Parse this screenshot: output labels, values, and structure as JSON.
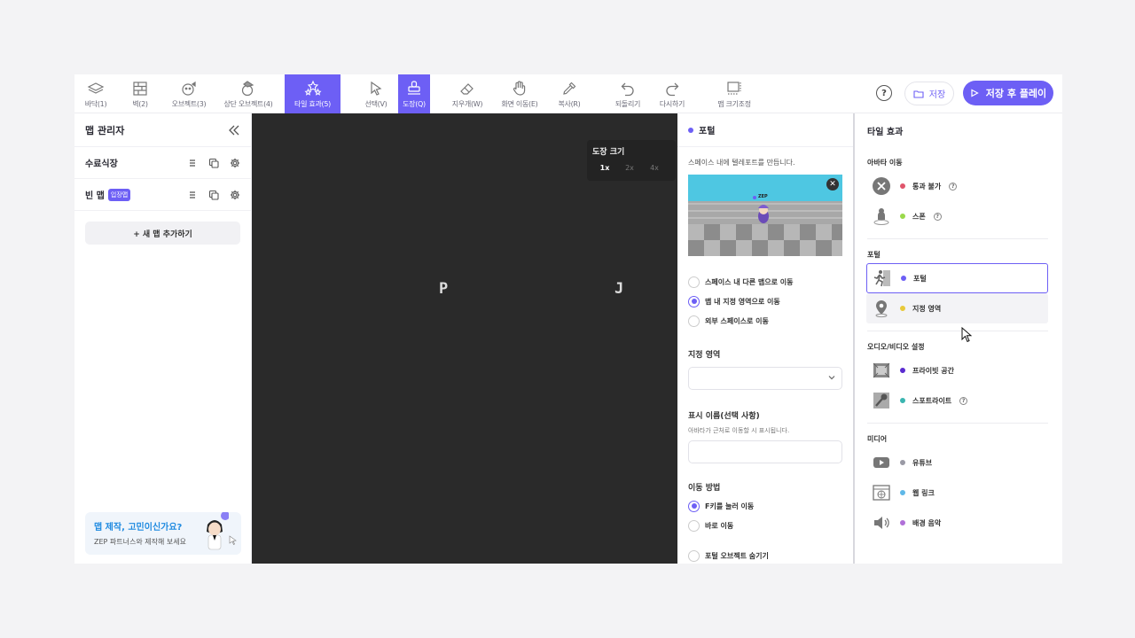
{
  "toolbar": {
    "tools": [
      {
        "label": "바닥(1)",
        "icon": "floor-icon"
      },
      {
        "label": "벽(2)",
        "icon": "wall-icon"
      },
      {
        "label": "오브젝트(3)",
        "icon": "object-icon"
      },
      {
        "label": "상단 오브젝트(4)",
        "icon": "top-object-icon"
      },
      {
        "label": "타일 효과(5)",
        "icon": "tile-effect-icon"
      },
      {
        "label": "선택(V)",
        "icon": "select-cursor-icon"
      },
      {
        "label": "도장(Q)",
        "icon": "stamp-icon"
      },
      {
        "label": "지우개(W)",
        "icon": "eraser-icon"
      },
      {
        "label": "화면 이동(E)",
        "icon": "hand-icon"
      },
      {
        "label": "복사(R)",
        "icon": "eyedropper-icon"
      },
      {
        "label": "되돌리기",
        "icon": "undo-icon"
      },
      {
        "label": "다시하기",
        "icon": "redo-icon"
      },
      {
        "label": "맵 크기조정",
        "icon": "resize-icon"
      }
    ],
    "help": "?",
    "save_label": "저장",
    "play_label": "저장 후 플레이"
  },
  "left_panel": {
    "title": "맵 관리자",
    "maps": [
      {
        "name": "수료식장",
        "badge": ""
      },
      {
        "name": "빈 맵",
        "badge": "입장맵"
      }
    ],
    "add_map": "+ 새 맵 추가하기",
    "promo": {
      "title": "맵 제작, 고민이신가요?",
      "subtitle": "ZEP 파트너스와 제작해 보세요"
    }
  },
  "canvas": {
    "tiles": [
      "P",
      "J"
    ],
    "brush_size": {
      "title": "도장 크기",
      "options": [
        "1x",
        "2x",
        "4x"
      ],
      "selected": "1x"
    }
  },
  "portal_panel": {
    "title": "포털",
    "dot_color": "#6d5ff5",
    "description": "스페이스 내에 텔레포트를 만듭니다.",
    "preview_label": "ZEP",
    "destination_options": [
      {
        "label": "스페이스 내 다른 맵으로 이동",
        "selected": false
      },
      {
        "label": "맵 내 지정 영역으로 이동",
        "selected": true
      },
      {
        "label": "외부 스페이스로 이동",
        "selected": false
      }
    ],
    "area_label": "지정 영역",
    "area_value": "",
    "display_name_label": "표시 이름(선택 사항)",
    "display_name_desc": "아바타가 근처로 이동할 시 표시됩니다.",
    "display_name_value": "",
    "move_method_label": "이동 방법",
    "move_methods": [
      {
        "label": "F키를 눌러 이동",
        "selected": true
      },
      {
        "label": "바로 이동",
        "selected": false
      }
    ],
    "hide_object_label": "포털 오브젝트 숨기기"
  },
  "effects_panel": {
    "title": "타일 효과",
    "groups": [
      {
        "name": "아바타 이동",
        "items": [
          {
            "label": "통과 불가",
            "dot": "#e0556b",
            "help": true,
            "icon": "blocked-icon"
          },
          {
            "label": "스폰",
            "dot": "#9ad94a",
            "help": true,
            "icon": "spawn-icon"
          }
        ]
      },
      {
        "name": "포털",
        "items": [
          {
            "label": "포털",
            "dot": "#6d5ff5",
            "help": false,
            "icon": "portal-run-icon"
          },
          {
            "label": "지정 영역",
            "dot": "#e8c93a",
            "help": false,
            "icon": "location-pin-icon"
          }
        ]
      },
      {
        "name": "오디오/비디오 설정",
        "items": [
          {
            "label": "프라이빗 공간",
            "dot": "#5a2bd0",
            "help": false,
            "icon": "private-space-icon"
          },
          {
            "label": "스포트라이트",
            "dot": "#3ab5b0",
            "help": true,
            "icon": "microphone-icon"
          }
        ]
      },
      {
        "name": "미디어",
        "items": [
          {
            "label": "유튜브",
            "dot": "#9a9aa5",
            "help": false,
            "icon": "youtube-icon"
          },
          {
            "label": "웹 링크",
            "dot": "#5fb8e8",
            "help": false,
            "icon": "web-link-icon"
          },
          {
            "label": "배경 음악",
            "dot": "#b070d8",
            "help": false,
            "icon": "speaker-icon"
          }
        ]
      }
    ]
  }
}
